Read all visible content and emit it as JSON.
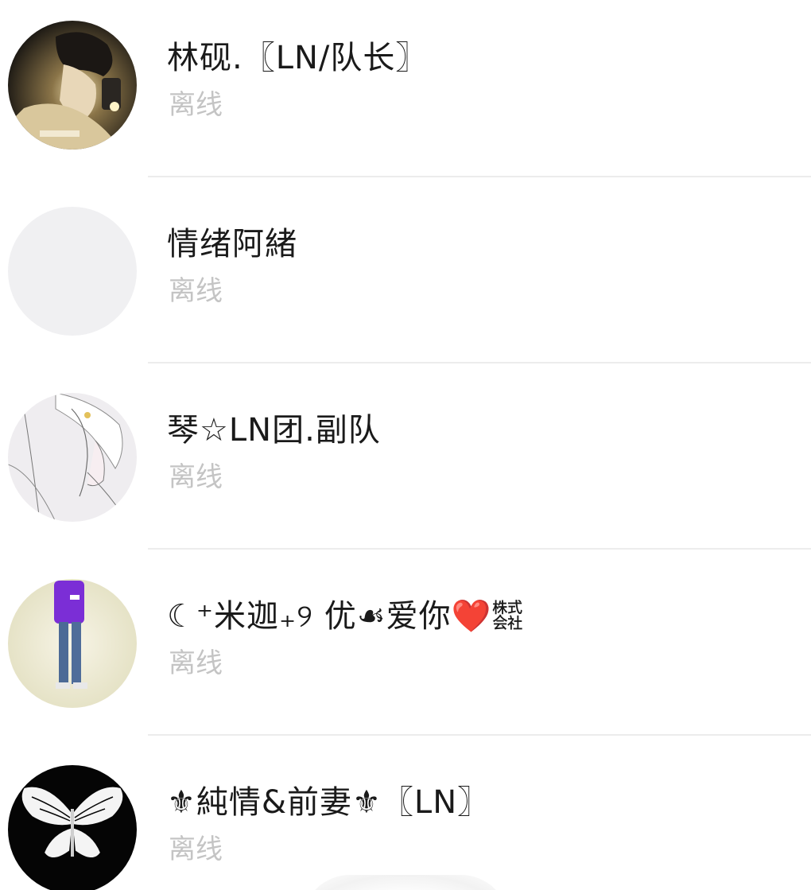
{
  "contacts": [
    {
      "name": "林砚.〖LN/队长〗",
      "status": "离线",
      "avatar_icon": "avatar-photo-dark"
    },
    {
      "name": "情绪阿緒",
      "status": "离线",
      "avatar_icon": "avatar-placeholder"
    },
    {
      "name": "琴☆LN团.副队",
      "status": "离线",
      "avatar_icon": "avatar-anime-sketch"
    },
    {
      "name": "☾⁺米迦₊୨ 优☙爱你❤️㍿",
      "status": "离线",
      "avatar_icon": "avatar-figure"
    },
    {
      "name": "⚜純情&前妻⚜〖LN〗",
      "status": "离线",
      "avatar_icon": "avatar-butterfly"
    }
  ],
  "colors": {
    "name_text": "#1a1a1a",
    "status_text": "#c4c4c4",
    "divider": "#ececec",
    "placeholder_avatar": "#f0f0f2"
  }
}
